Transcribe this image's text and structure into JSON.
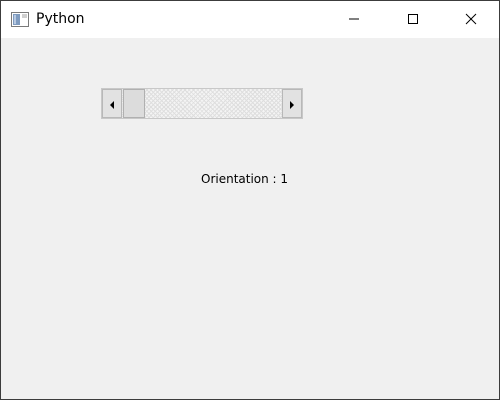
{
  "window": {
    "title": "Python",
    "app_icon": "window-app-icon",
    "controls": {
      "minimize_icon": "minimize-icon",
      "maximize_icon": "maximize-icon",
      "close_icon": "close-icon"
    }
  },
  "scrollbar": {
    "orientation": "horizontal",
    "value_fraction": 0.0,
    "left_arrow_icon": "left-arrow-icon",
    "right_arrow_icon": "right-arrow-icon"
  },
  "status": {
    "orientation_text": "Orientation : 1"
  },
  "colors": {
    "titlebar_bg": "#ffffff",
    "client_bg": "#f0f0f0",
    "track_bg": "#f4f4f4",
    "thumb_bg": "#dcdcdc",
    "text": "#000000"
  }
}
